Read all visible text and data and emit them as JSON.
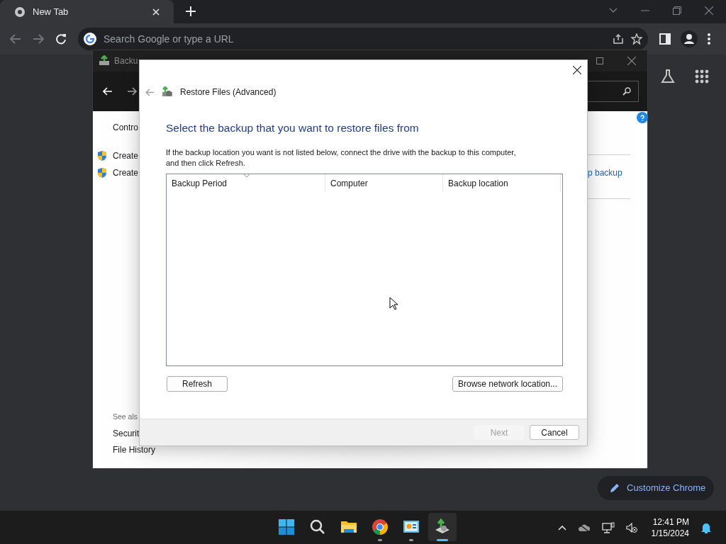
{
  "browser": {
    "tab": {
      "title": "New Tab"
    },
    "omnibox": {
      "placeholder": "Search Google or type a URL"
    },
    "customize_button": "Customize Chrome"
  },
  "back_window": {
    "title": "Backu",
    "sidebar": {
      "items": [
        {
          "label": "Contro",
          "kind": "text"
        },
        {
          "label": "Create",
          "kind": "shield"
        },
        {
          "label": "Create",
          "kind": "shield"
        }
      ],
      "see_also": "See als",
      "links": [
        "Securit",
        "File History"
      ]
    },
    "right_link": "p backup"
  },
  "dialog": {
    "title": "Restore Files (Advanced)",
    "heading": "Select the backup that you want to restore files from",
    "instructions": "If the backup location you want is not listed below, connect the drive with the backup to this computer, and then click Refresh.",
    "table": {
      "columns": [
        "Backup Period",
        "Computer",
        "Backup location"
      ]
    },
    "refresh_button": "Refresh",
    "browse_button": "Browse network location...",
    "footer_buttons": [
      {
        "label": "Next",
        "disabled": true
      },
      {
        "label": "Cancel",
        "disabled": false
      }
    ]
  },
  "taskbar": {
    "apps": [
      {
        "kind": "start",
        "running": false,
        "selected": false
      },
      {
        "kind": "search",
        "running": false,
        "selected": false
      },
      {
        "kind": "folder",
        "running": false,
        "selected": false
      },
      {
        "kind": "browser",
        "running": true,
        "selected": false
      },
      {
        "kind": "panel",
        "running": true,
        "selected": false
      },
      {
        "kind": "backup",
        "running": true,
        "selected": true
      }
    ],
    "time": "12:41 PM",
    "date": "1/15/2024"
  }
}
